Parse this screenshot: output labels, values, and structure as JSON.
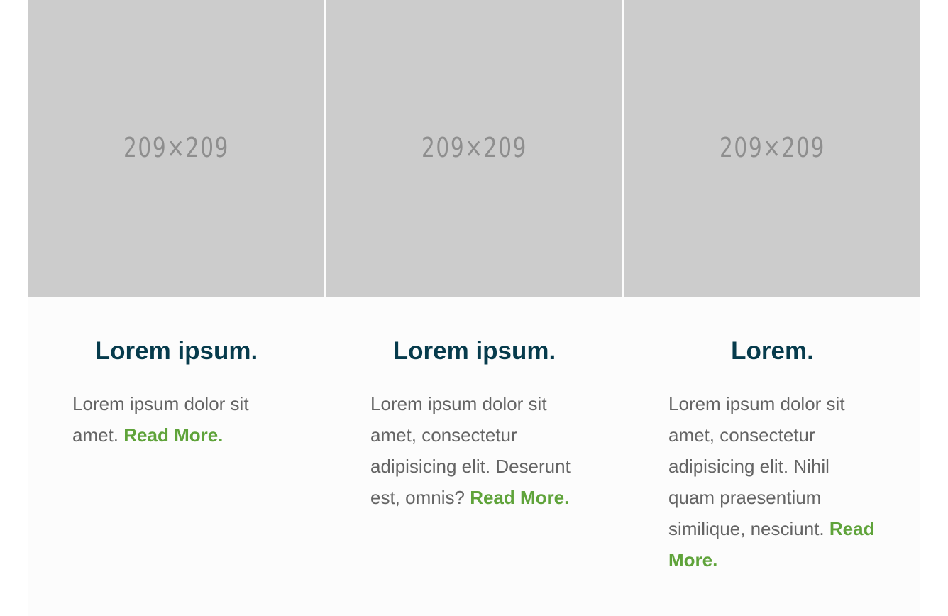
{
  "cards": [
    {
      "image_label": "209×209",
      "title": "Lorem ipsum.",
      "text": "Lorem ipsum dolor sit amet.",
      "link": "Read More."
    },
    {
      "image_label": "209×209",
      "title": "Lorem ipsum.",
      "text": "Lorem ipsum dolor sit amet, consectetur adipisicing elit. Deserunt est, omnis?",
      "link": "Read More."
    },
    {
      "image_label": "209×209",
      "title": "Lorem.",
      "text": "Lorem ipsum dolor sit amet, consectetur adipisicing elit. Nihil quam praesentium similique, nesciunt.",
      "link": "Read More."
    }
  ],
  "colors": {
    "title": "#063b4c",
    "text": "#646464",
    "link": "#5fa33a",
    "placeholder_bg": "#cccccc",
    "placeholder_text": "#8e8e8e",
    "card_bg": "#fcfcfc"
  }
}
